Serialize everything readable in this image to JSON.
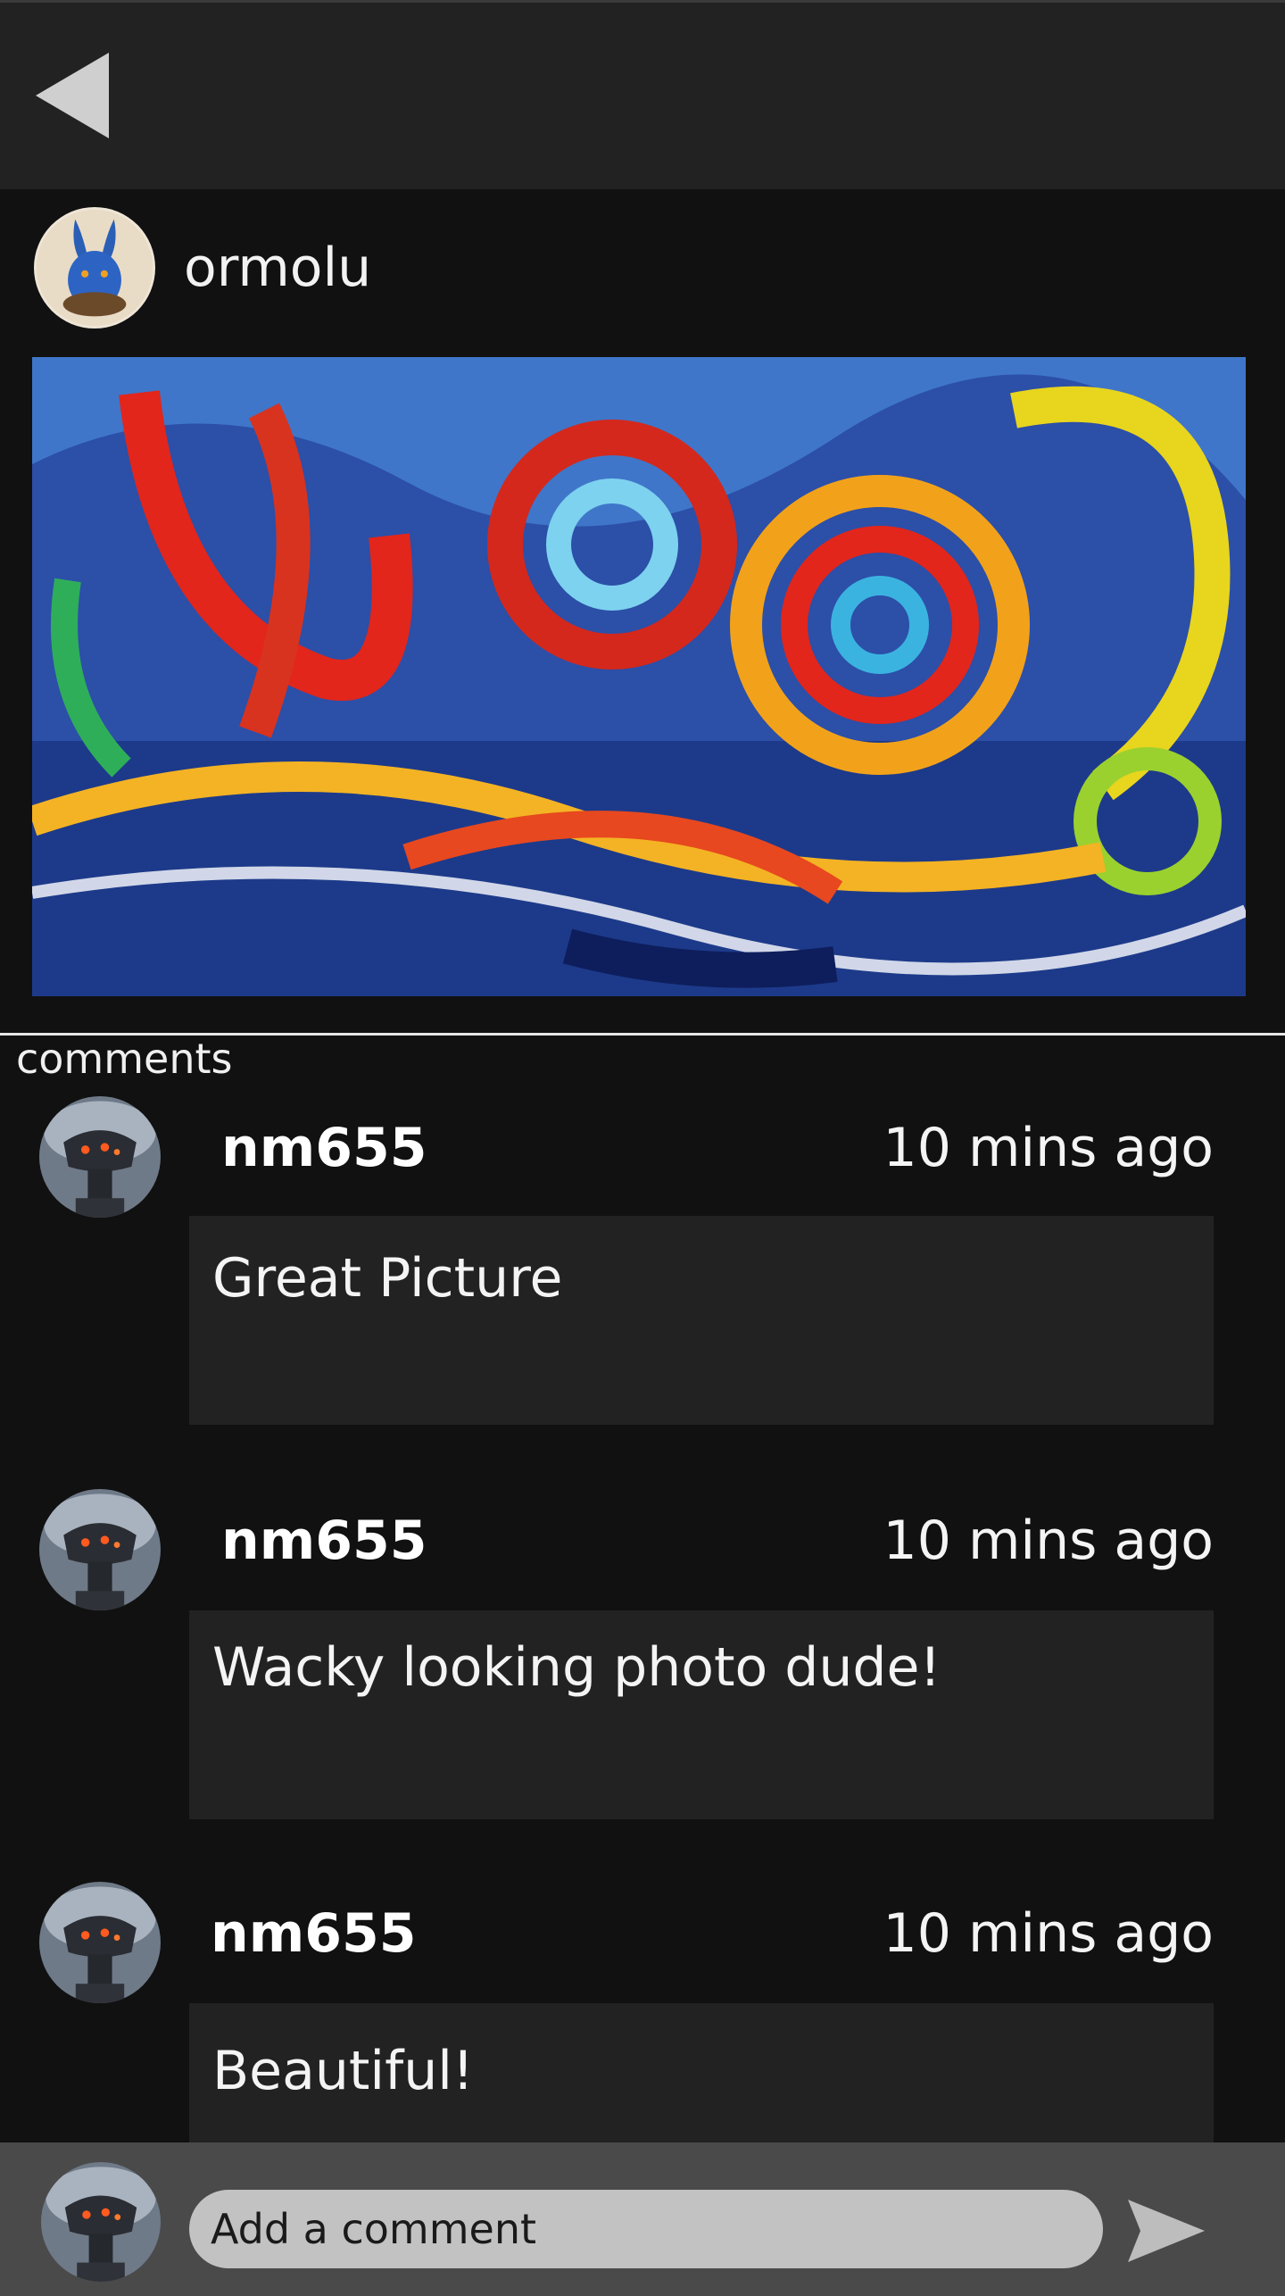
{
  "header": {
    "back_icon": "back-triangle-icon"
  },
  "post": {
    "author": "ormolu",
    "author_avatar": "rabbit-avatar",
    "image": "abstract-swirl-painting"
  },
  "comments_section": {
    "heading": "comments",
    "items": [
      {
        "user": "nm655",
        "time": "10 mins ago",
        "text": "Great Picture",
        "avatar": "robot-avatar"
      },
      {
        "user": "nm655",
        "time": "10 mins ago",
        "text": "Wacky looking photo dude!",
        "avatar": "robot-avatar"
      },
      {
        "user": "nm655",
        "time": "10 mins ago",
        "text": "Beautiful!",
        "avatar": "robot-avatar"
      }
    ]
  },
  "composer": {
    "placeholder": "Add a comment",
    "avatar": "robot-avatar",
    "send_icon": "send-arrow-icon"
  },
  "colors": {
    "background": "#111111",
    "header": "#222222",
    "comment_box": "#222222",
    "composer_bar": "#4a4a4a",
    "input": "#c2c2c2"
  }
}
